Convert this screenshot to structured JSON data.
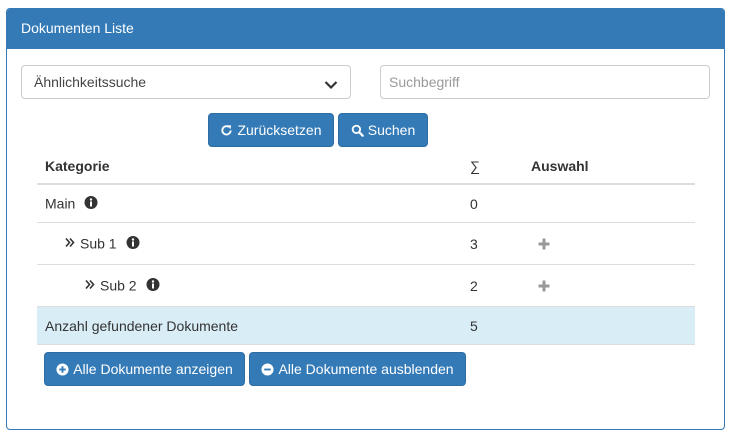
{
  "panel": {
    "title": "Dokumenten Liste"
  },
  "search": {
    "mode_selected": "Ähnlichkeitssuche",
    "placeholder": "Suchbegriff",
    "reset_label": "Zurücksetzen",
    "search_label": "Suchen"
  },
  "table": {
    "headers": {
      "category": "Kategorie",
      "sum": "∑",
      "selection": "Auswahl"
    },
    "rows": [
      {
        "label": "Main",
        "count": "0"
      },
      {
        "label": "Sub 1",
        "count": "3"
      },
      {
        "label": "Sub 2",
        "count": "2"
      }
    ],
    "total": {
      "label": "Anzahl gefundener Dokumente",
      "count": "5"
    }
  },
  "actions": {
    "show_all": "Alle Dokumente anzeigen",
    "hide_all": "Alle Dokumente ausblenden"
  },
  "icons": {
    "reset": "refresh-icon",
    "search": "search-icon",
    "info": "info-icon",
    "expand": "double-chevron-right-icon",
    "add": "plus-icon",
    "show": "plus-circle-icon",
    "hide": "minus-circle-icon"
  },
  "colors": {
    "primary": "#337ab7",
    "total_row": "#d9edf7"
  }
}
